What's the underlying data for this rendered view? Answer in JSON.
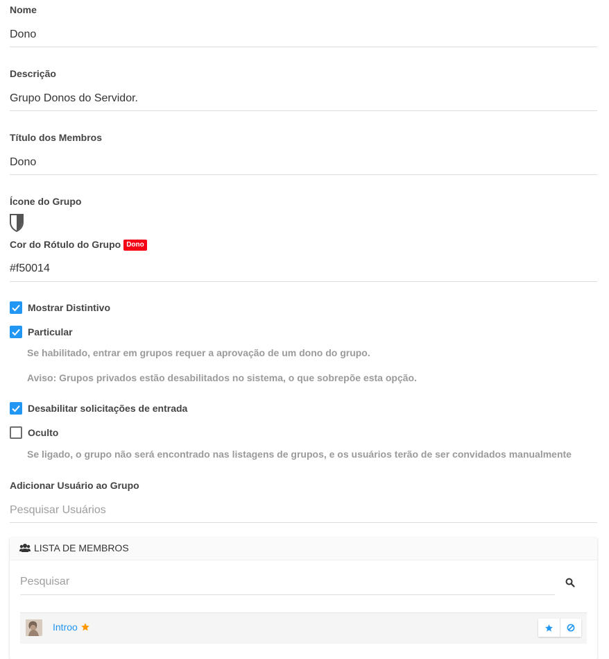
{
  "form": {
    "name": {
      "label": "Nome",
      "value": "Dono"
    },
    "description": {
      "label": "Descrição",
      "value": "Grupo Donos do Servidor."
    },
    "member_title": {
      "label": "Título dos Membros",
      "value": "Dono"
    },
    "group_icon": {
      "label": "Ícone do Grupo",
      "icon": "shield-icon"
    },
    "label_color": {
      "label": "Cor do Rótulo do Grupo",
      "badge_text": "Dono",
      "value": "#f50014",
      "badge_color": "#f50014"
    },
    "options": {
      "show_badge": {
        "label": "Mostrar Distintivo",
        "checked": true
      },
      "private": {
        "label": "Particular",
        "checked": true,
        "help": "Se habilitado, entrar em grupos requer a aprovação de um dono do grupo.",
        "warning": "Aviso: Grupos privados estão desabilitados no sistema, o que sobrepõe esta opção."
      },
      "disable_join_requests": {
        "label": "Desabilitar solicitações de entrada",
        "checked": true
      },
      "hidden": {
        "label": "Oculto",
        "checked": false,
        "help": "Se ligado, o grupo não será encontrado nas listagens de grupos, e os usuários terão de ser convidados manualmente"
      }
    },
    "add_user": {
      "label": "Adicionar Usuário ao Grupo",
      "placeholder": "Pesquisar Usuários"
    }
  },
  "members_panel": {
    "title": "LISTA DE MEMBROS",
    "title_icon": "users-icon",
    "search_placeholder": "Pesquisar",
    "members": [
      {
        "name": "Introo",
        "is_owner": true
      }
    ]
  },
  "colors": {
    "accent": "#2196f3",
    "owner_star": "#ff9800",
    "badge": "#f50014"
  }
}
